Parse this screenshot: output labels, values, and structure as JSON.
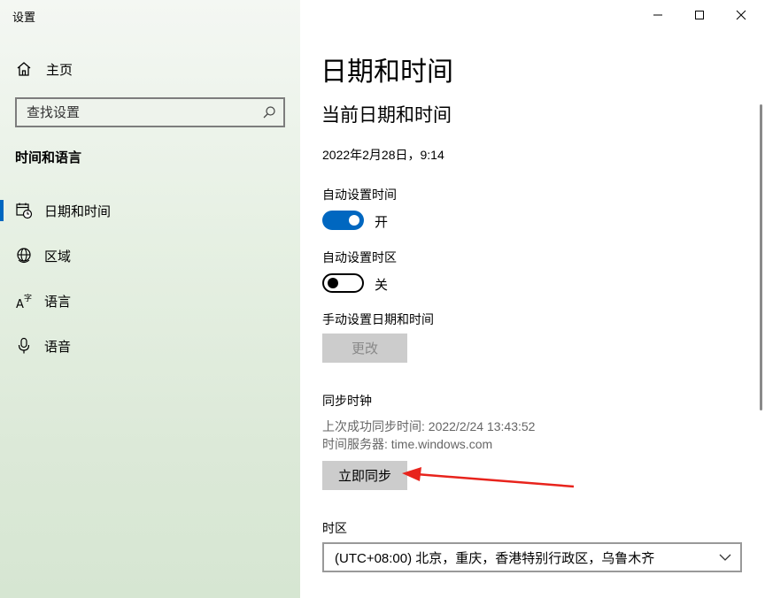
{
  "window": {
    "title": "设置",
    "controls": [
      "minimize-icon",
      "maximize-icon",
      "close-icon"
    ]
  },
  "sidebar": {
    "home_label": "主页",
    "search_placeholder": "查找设置",
    "section_title": "时间和语言",
    "items": [
      {
        "label": "日期和时间",
        "icon": "calendar-clock-icon",
        "selected": true
      },
      {
        "label": "区域",
        "icon": "globe-icon",
        "selected": false
      },
      {
        "label": "语言",
        "icon": "language-icon",
        "selected": false
      },
      {
        "label": "语音",
        "icon": "microphone-icon",
        "selected": false
      }
    ]
  },
  "main": {
    "title": "日期和时间",
    "subtitle": "当前日期和时间",
    "current_datetime": "2022年2月28日，9:14",
    "auto_time": {
      "label": "自动设置时间",
      "state": "开",
      "on": true
    },
    "auto_timezone": {
      "label": "自动设置时区",
      "state": "关",
      "on": false
    },
    "manual": {
      "label": "手动设置日期和时间",
      "button": "更改"
    },
    "sync": {
      "label": "同步时钟",
      "last_sync": "上次成功同步时间: 2022/2/24 13:43:52",
      "server": "时间服务器: time.windows.com",
      "button": "立即同步"
    },
    "timezone": {
      "label": "时区",
      "value": "(UTC+08:00) 北京，重庆，香港特别行政区，乌鲁木齐"
    }
  },
  "colors": {
    "accent": "#0067c0",
    "annotation_arrow": "#e8231c"
  }
}
